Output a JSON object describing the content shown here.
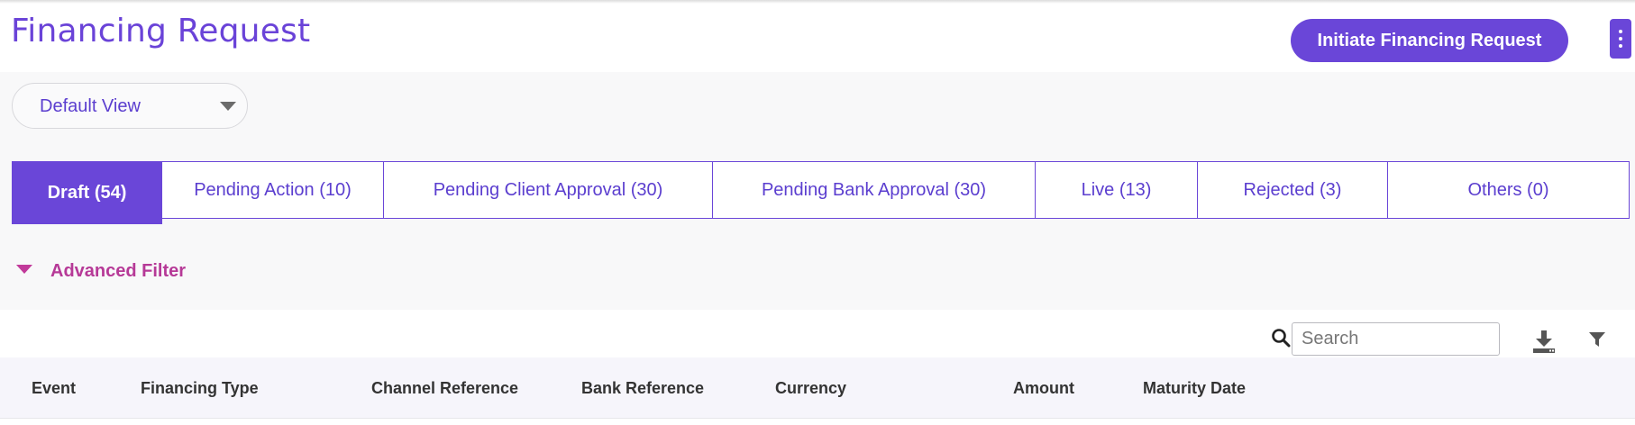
{
  "header": {
    "title": "Financing Request",
    "primary_action": "Initiate Financing Request",
    "more_menu_icon": "kebab-vertical-icon"
  },
  "view_selector": {
    "selected": "Default View",
    "icon": "caret-down-icon"
  },
  "tabs": [
    {
      "label": "Draft (54)",
      "active": true
    },
    {
      "label": "Pending Action (10)",
      "active": false
    },
    {
      "label": "Pending Client Approval (30)",
      "active": false
    },
    {
      "label": "Pending Bank Approval (30)",
      "active": false
    },
    {
      "label": "Live (13)",
      "active": false
    },
    {
      "label": "Rejected (3)",
      "active": false
    },
    {
      "label": "Others (0)",
      "active": false
    }
  ],
  "advanced_filter": {
    "label": "Advanced Filter",
    "icon": "caret-down-icon"
  },
  "toolbar": {
    "search_placeholder": "Search",
    "search_icon": "search-icon",
    "download_icon": "download-icon",
    "filter_icon": "filter-icon"
  },
  "table": {
    "columns": [
      "Event",
      "Financing Type",
      "Channel Reference",
      "Bank Reference",
      "Currency",
      "Amount",
      "Maturity Date"
    ]
  },
  "colors": {
    "primary": "#6a46d8",
    "accent_filter": "#b63997"
  }
}
